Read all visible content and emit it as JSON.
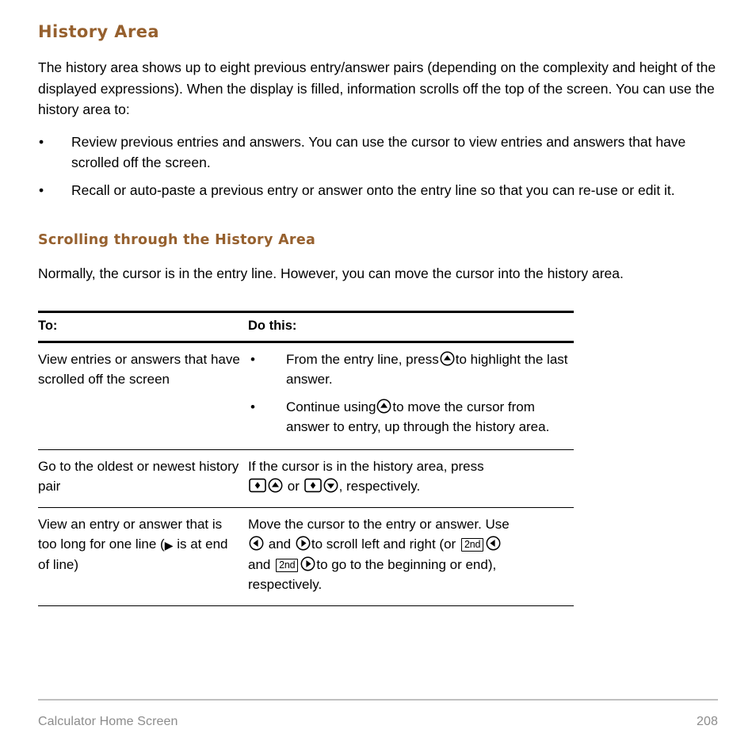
{
  "heading": "History Area",
  "intro_paragraph": "The history area shows up to eight previous entry/answer pairs (depending on the complexity and height of the displayed expressions). When the display is filled, information scrolls off the top of the screen. You can use the history area to:",
  "bullet_char": "•",
  "bullets": [
    "Review previous entries and answers. You can use the cursor to view entries and answers that have scrolled off the screen.",
    "Recall or auto-paste a previous entry or answer onto the entry line so that you can re-use or edit it."
  ],
  "subheading": "Scrolling through the History Area",
  "sub_paragraph": "Normally, the cursor is in the entry line. However, you can move the cursor into the history area.",
  "table": {
    "headers": [
      "To:",
      "Do this:"
    ],
    "rows": [
      {
        "to": "View entries or answers that have scrolled off the screen",
        "do_bullets": [
          {
            "part1": "From the entry line, press",
            "icon": "cursor-up-key-icon",
            "part2": "to highlight the last answer."
          },
          {
            "part1": "Continue using",
            "icon": "cursor-up-key-icon",
            "part2": "to move the cursor from answer to entry, up through the history area."
          }
        ]
      },
      {
        "to": "Go to the oldest or newest history pair",
        "do_line1": "If the cursor is in the history area, press",
        "do_or": "or",
        "do_end": ", respectively.",
        "icons": [
          "diamond-key-icon",
          "cursor-up-key-icon",
          "diamond-key-icon",
          "cursor-down-key-icon"
        ]
      },
      {
        "to_part1": "View an entry or answer that is too long for one line (",
        "to_glyph": "▶",
        "to_part2": " is at end of line)",
        "do_part1": "Move the cursor to the entry or answer. Use",
        "do_and1": "and",
        "do_part2": "to scroll left and right (or",
        "do_and2": "and",
        "do_part3": "to go to the beginning or end), respectively.",
        "key_label": "2nd"
      }
    ]
  },
  "footer": {
    "section": "Calculator Home Screen",
    "page_number": "208"
  },
  "colors": {
    "heading": "#96602E",
    "body_text": "#000000",
    "footer_text": "#8C8C8C",
    "footer_rule": "#BFBFBF"
  }
}
